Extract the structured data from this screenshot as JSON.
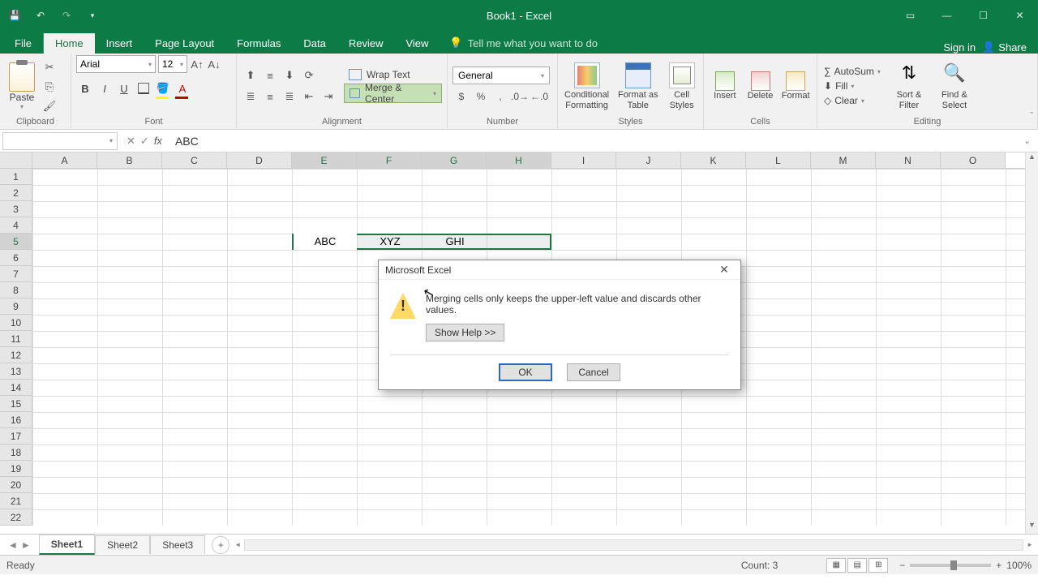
{
  "titlebar": {
    "title": "Book1 - Excel"
  },
  "tabs": {
    "file": "File",
    "home": "Home",
    "insert": "Insert",
    "pageLayout": "Page Layout",
    "formulas": "Formulas",
    "data": "Data",
    "review": "Review",
    "view": "View",
    "tellme": "Tell me what you want to do",
    "signin": "Sign in",
    "share": "Share"
  },
  "ribbon": {
    "clipboard": {
      "paste": "Paste",
      "label": "Clipboard"
    },
    "font": {
      "name": "Arial",
      "size": "12",
      "label": "Font"
    },
    "alignment": {
      "wrap": "Wrap Text",
      "merge": "Merge & Center",
      "label": "Alignment"
    },
    "number": {
      "format": "General",
      "label": "Number"
    },
    "styles": {
      "cf": "Conditional Formatting",
      "ft": "Format as Table",
      "cs": "Cell Styles",
      "label": "Styles"
    },
    "cells": {
      "insert": "Insert",
      "delete": "Delete",
      "format": "Format",
      "label": "Cells"
    },
    "editing": {
      "autosum": "AutoSum",
      "fill": "Fill",
      "clear": "Clear",
      "sort": "Sort & Filter",
      "find": "Find & Select",
      "label": "Editing"
    }
  },
  "formulaBar": {
    "nameBox": "",
    "formula": "ABC"
  },
  "grid": {
    "columns": [
      "A",
      "B",
      "C",
      "D",
      "E",
      "F",
      "G",
      "H",
      "I",
      "J",
      "K",
      "L",
      "M",
      "N",
      "O"
    ],
    "rowcount": 22,
    "e5": "ABC",
    "f5": "XYZ",
    "g5": "GHI"
  },
  "dialog": {
    "title": "Microsoft Excel",
    "message": "Merging cells only keeps the upper-left value and discards other values.",
    "showHelp": "Show Help >>",
    "ok": "OK",
    "cancel": "Cancel"
  },
  "sheets": {
    "s1": "Sheet1",
    "s2": "Sheet2",
    "s3": "Sheet3"
  },
  "status": {
    "ready": "Ready",
    "count": "Count: 3",
    "zoom": "100%"
  }
}
